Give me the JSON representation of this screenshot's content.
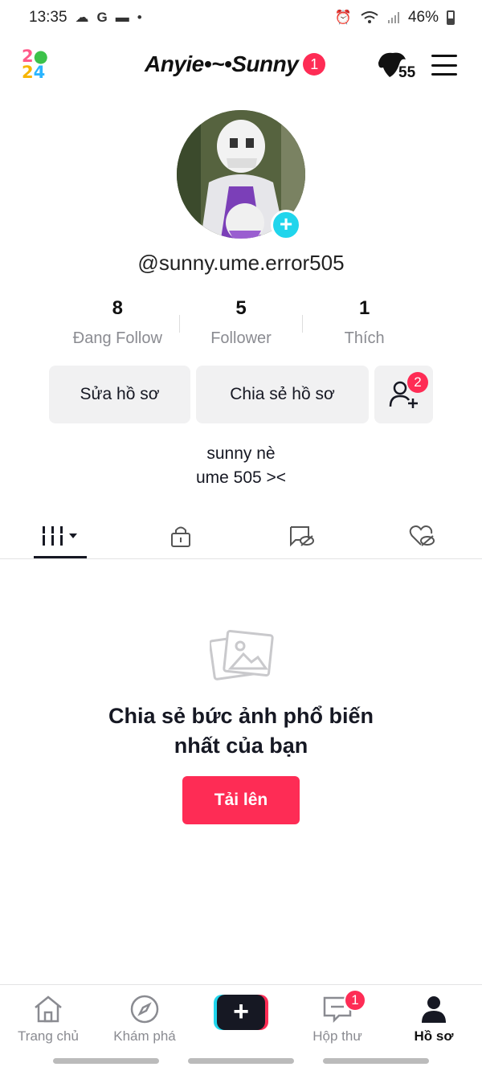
{
  "status_bar": {
    "time": "13:35",
    "battery": "46%"
  },
  "header": {
    "profile_name": "Anyie•~•Sunny",
    "name_badge": "1",
    "friends_count": "55"
  },
  "profile": {
    "username": "@sunny.ume.error505",
    "stats": [
      {
        "value": "8",
        "label": "Đang Follow"
      },
      {
        "value": "5",
        "label": "Follower"
      },
      {
        "value": "1",
        "label": "Thích"
      }
    ],
    "edit_button": "Sửa hồ sơ",
    "share_button": "Chia sẻ hồ sơ",
    "friend_badge": "2",
    "bio_line1": "sunny nè",
    "bio_line2": "ume 505 ><"
  },
  "tabs": [
    {
      "icon": "grid-icon",
      "active": true
    },
    {
      "icon": "lock-icon"
    },
    {
      "icon": "hidden-post-icon"
    },
    {
      "icon": "hidden-liked-icon"
    }
  ],
  "empty_state": {
    "line1": "Chia sẻ bức ảnh phổ biến",
    "line2": "nhất của bạn",
    "upload_button": "Tải lên"
  },
  "bottom_nav": {
    "home": "Trang chủ",
    "discover": "Khám phá",
    "inbox": "Hộp thư",
    "inbox_badge": "1",
    "profile": "Hồ sơ"
  },
  "colors": {
    "accent": "#fe2c55",
    "cyan": "#20d5ec",
    "text": "#161823",
    "muted": "#8a8b91"
  }
}
